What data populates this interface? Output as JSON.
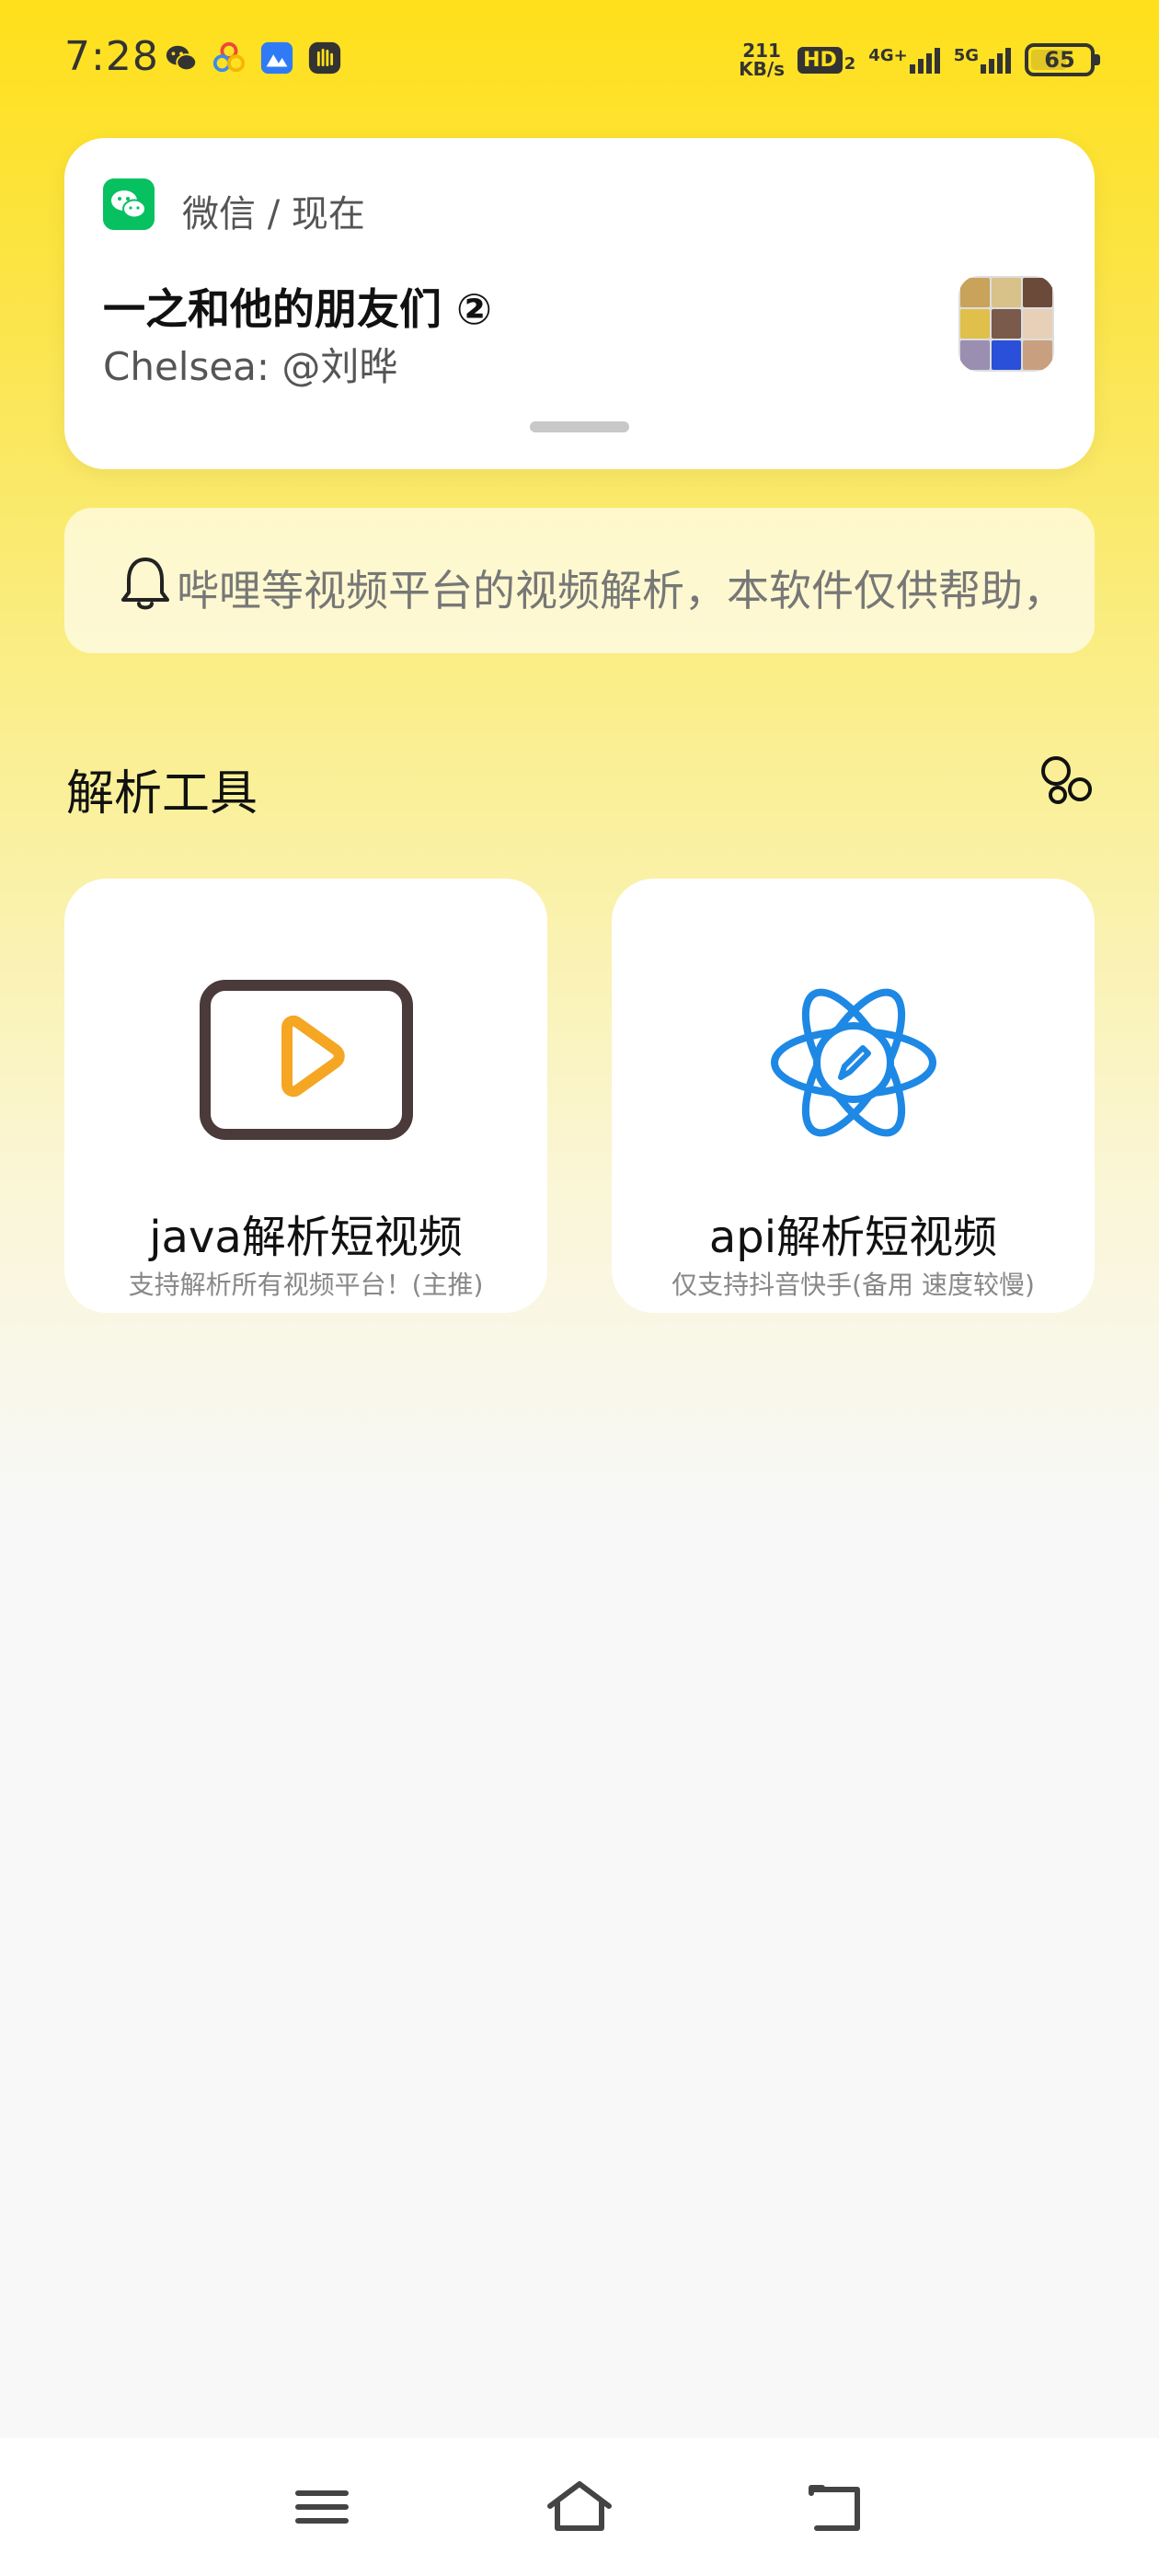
{
  "status_bar": {
    "time": "7:28",
    "net_speed_value": "211",
    "net_speed_unit": "KB/s",
    "hd_label": "HD",
    "hd_sub": "2",
    "signal_1_label": "4G+",
    "signal_2_label": "5G",
    "battery": "65",
    "battery_level": 0.65,
    "notification_icons": [
      "wechat-icon",
      "petal-icon",
      "gallery-icon",
      "hand-icon"
    ]
  },
  "notification": {
    "app": "微信 / 现在",
    "title": "一之和他的朋友们 ②",
    "body": "Chelsea: @刘晔",
    "accent": "#07C160"
  },
  "notice": {
    "text": "哔哩等视频平台的视频解析，本软件仅供帮助，",
    "icon": "bell-icon"
  },
  "section": {
    "title": "解析工具",
    "icon": "bubbles-icon"
  },
  "tools": [
    {
      "title": "java解析短视频",
      "subtitle": "支持解析所有视频平台！(主推)",
      "icon": "video-play-icon",
      "color": "#4A3A3A",
      "accent": "#F5A623"
    },
    {
      "title": "api解析短视频",
      "subtitle": "仅支持抖音快手(备用 速度较慢)",
      "icon": "atom-edit-icon",
      "color": "#1E88E5"
    }
  ],
  "nav": {
    "items": [
      "menu-icon",
      "home-icon",
      "back-icon"
    ]
  }
}
